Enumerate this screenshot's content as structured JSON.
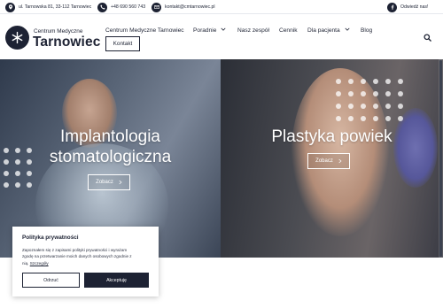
{
  "topbar": {
    "address": "ul. Tarnowska 81, 33-112 Tarnowiec",
    "phone": "+48 690 560 743",
    "email": "kontakt@cmtarnowiec.pl",
    "facebook_label": "Odwiedź nas!"
  },
  "logo": {
    "top_text": "Centrum Medyczne",
    "main_text": "Tarnowiec"
  },
  "nav": {
    "items": [
      {
        "label": "Centrum Medyczne Tarnowiec",
        "dropdown": false
      },
      {
        "label": "Poradnie",
        "dropdown": true
      },
      {
        "label": "Nasz zespół",
        "dropdown": false
      },
      {
        "label": "Cennik",
        "dropdown": false
      },
      {
        "label": "Dla pacjenta",
        "dropdown": true
      },
      {
        "label": "Blog",
        "dropdown": false
      }
    ],
    "kontakt_label": "Kontakt"
  },
  "hero": {
    "slides": [
      {
        "title_line1": "Implantologia",
        "title_line2": "stomatologiczna",
        "button": "Zobacz"
      },
      {
        "title_line1": "Plastyka powiek",
        "button": "Zobacz"
      }
    ]
  },
  "cookie": {
    "title": "Polityka prywatności",
    "text_line1": "Zapoznałem się z zapisami polityki prywatności i wyrażam",
    "text_line2": "zgodę na przetwarzanie moich danych osobowych zgodnie z",
    "text_line3_prefix": "nią.",
    "link_label": "Szczegóły",
    "refuse_label": "Odrzuć",
    "accept_label": "Akceptuję"
  },
  "colors": {
    "brand_dark": "#1d2233",
    "white": "#ffffff"
  },
  "icons": [
    "location-icon",
    "phone-icon",
    "email-icon",
    "facebook-icon",
    "search-icon",
    "chevron-down-icon",
    "arrow-right-icon"
  ]
}
